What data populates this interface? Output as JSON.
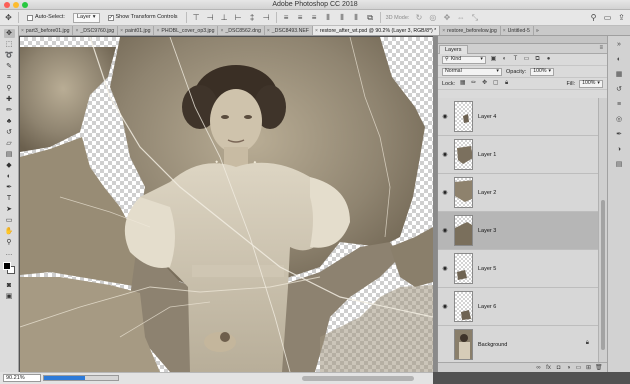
{
  "app": {
    "title": "Adobe Photoshop CC 2018",
    "traffic_lights": [
      "#fc5f57",
      "#fdbc2e",
      "#28c840"
    ]
  },
  "options_bar": {
    "auto_select_label": "Auto-Select:",
    "auto_select_value": "Layer",
    "show_transform_label": "Show Transform Controls",
    "mode_3d_label": "3D Mode:"
  },
  "tabs": [
    {
      "label": "part3_before01.jpg"
    },
    {
      "label": "_DSC9760.jpg"
    },
    {
      "label": "paint01.jpg"
    },
    {
      "label": "PHOBL_cover_op3.jpg"
    },
    {
      "label": "_DSC8562.dng"
    },
    {
      "label": "_DSC8493.NEF"
    },
    {
      "label": "restore_after_wt.psd @ 90.2% (Layer 3, RGB/8*) *",
      "active": true
    },
    {
      "label": "restore_beforelow.jpg"
    },
    {
      "label": "Untitled-5"
    }
  ],
  "tools": [
    {
      "name": "move-tool",
      "glyph": "✥",
      "selected": true
    },
    {
      "name": "marquee-tool",
      "glyph": "⬚"
    },
    {
      "name": "lasso-tool",
      "glyph": "➰"
    },
    {
      "name": "quick-select-tool",
      "glyph": "✎"
    },
    {
      "name": "crop-tool",
      "glyph": "⌗"
    },
    {
      "name": "eyedropper-tool",
      "glyph": "⚲"
    },
    {
      "name": "healing-brush-tool",
      "glyph": "✚"
    },
    {
      "name": "brush-tool",
      "glyph": "✏"
    },
    {
      "name": "clone-stamp-tool",
      "glyph": "♣"
    },
    {
      "name": "history-brush-tool",
      "glyph": "↺"
    },
    {
      "name": "eraser-tool",
      "glyph": "▱"
    },
    {
      "name": "gradient-tool",
      "glyph": "▤"
    },
    {
      "name": "blur-tool",
      "glyph": "◆"
    },
    {
      "name": "dodge-tool",
      "glyph": "◐"
    },
    {
      "name": "pen-tool",
      "glyph": "✒"
    },
    {
      "name": "type-tool",
      "glyph": "T"
    },
    {
      "name": "path-select-tool",
      "glyph": "➤"
    },
    {
      "name": "shape-tool",
      "glyph": "▭"
    },
    {
      "name": "hand-tool",
      "glyph": "✋"
    },
    {
      "name": "zoom-tool",
      "glyph": "⚲"
    },
    {
      "name": "more-tools",
      "glyph": "…"
    }
  ],
  "status": {
    "zoom": "90.21%",
    "progress": 0.55
  },
  "layers_panel": {
    "tab_label": "Layers",
    "filter_kind": "Kind",
    "blend_mode": "Normal",
    "opacity_label": "Opacity:",
    "opacity_value": "100%",
    "lock_label": "Lock:",
    "fill_label": "Fill:",
    "fill_value": "100%",
    "layers": [
      {
        "name": "Layer 4",
        "visible": true,
        "selected": false
      },
      {
        "name": "Layer 1",
        "visible": true,
        "selected": false
      },
      {
        "name": "Layer 2",
        "visible": true,
        "selected": false
      },
      {
        "name": "Layer 3",
        "visible": true,
        "selected": true
      },
      {
        "name": "Layer 5",
        "visible": true,
        "selected": false
      },
      {
        "name": "Layer 6",
        "visible": true,
        "selected": false
      },
      {
        "name": "Background",
        "visible": false,
        "selected": false,
        "locked": true
      }
    ]
  }
}
